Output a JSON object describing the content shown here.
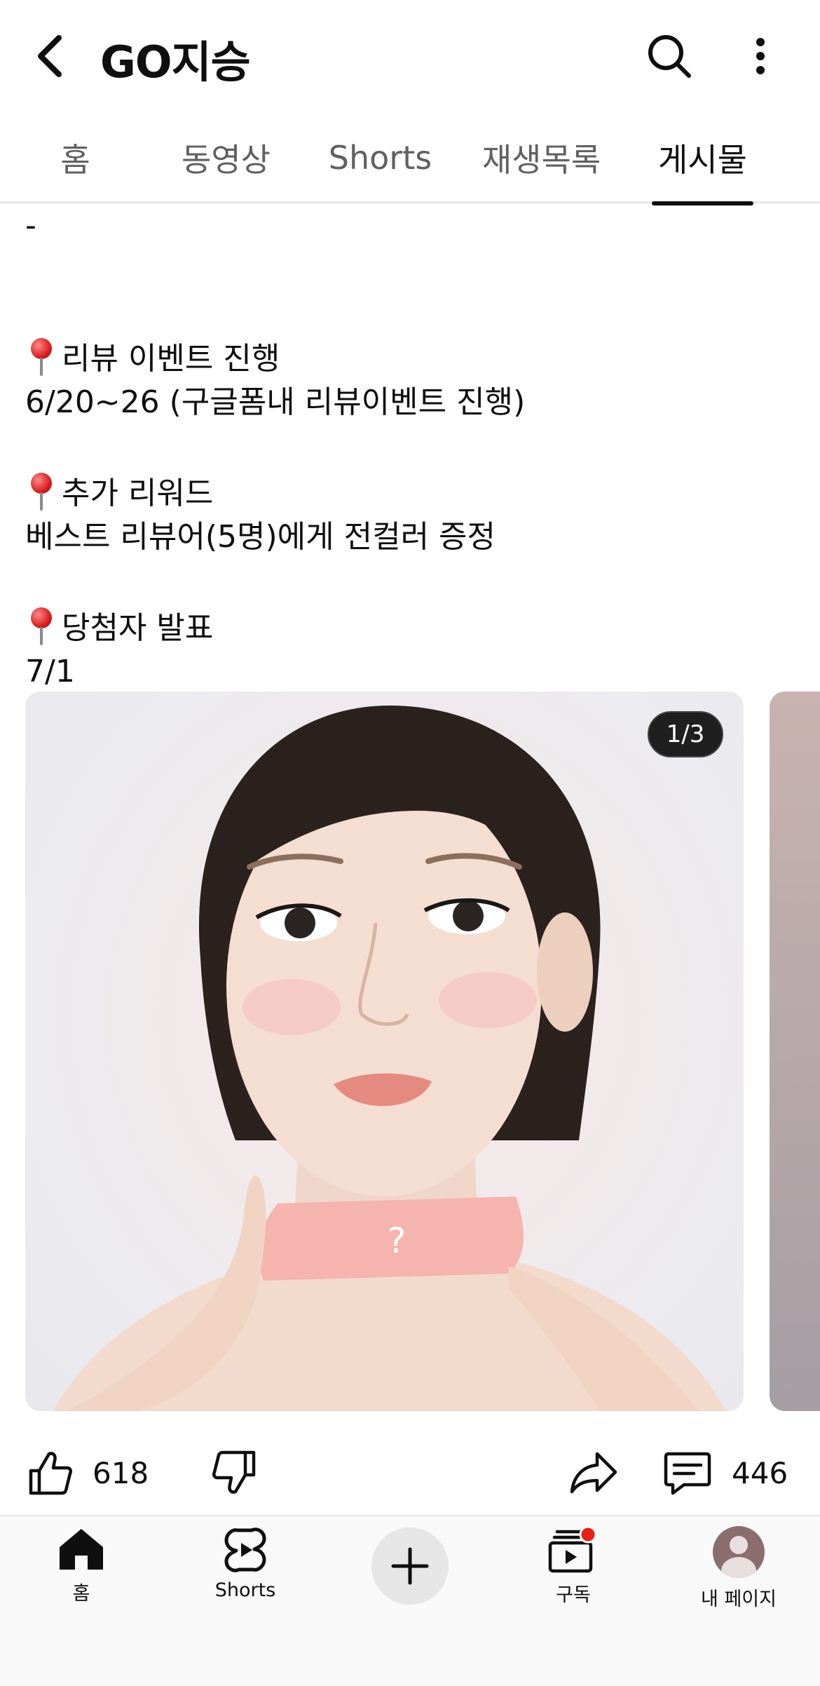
{
  "header": {
    "title": "GO지승",
    "back_icon": "arrow-back-icon",
    "search_icon": "search-icon",
    "more_icon": "more-vertical-icon"
  },
  "tabs": [
    {
      "label": "홈",
      "active": false
    },
    {
      "label": "동영상",
      "active": false
    },
    {
      "label": "Shorts",
      "active": false
    },
    {
      "label": "재생목록",
      "active": false
    },
    {
      "label": "게시물",
      "active": true
    }
  ],
  "post": {
    "lines": [
      "-",
      "",
      "",
      "리뷰 이벤트 진행",
      "6/20~26 (구글폼내 리뷰이벤트 진행)",
      "",
      "추가 리워드",
      "베스트 리뷰어(5명)에게 전컬러 증정",
      "",
      "당첨자 발표",
      "7/1"
    ],
    "image_counter": "1/3",
    "image_overlay_text": "?"
  },
  "actions": {
    "like_count": "618",
    "comment_count": "446"
  },
  "bottom_nav": {
    "home": "홈",
    "shorts": "Shorts",
    "subscriptions": "구독",
    "profile": "내 페이지"
  },
  "colors": {
    "text": "#0f0f0f",
    "muted": "#606060",
    "notification": "#e62117"
  }
}
